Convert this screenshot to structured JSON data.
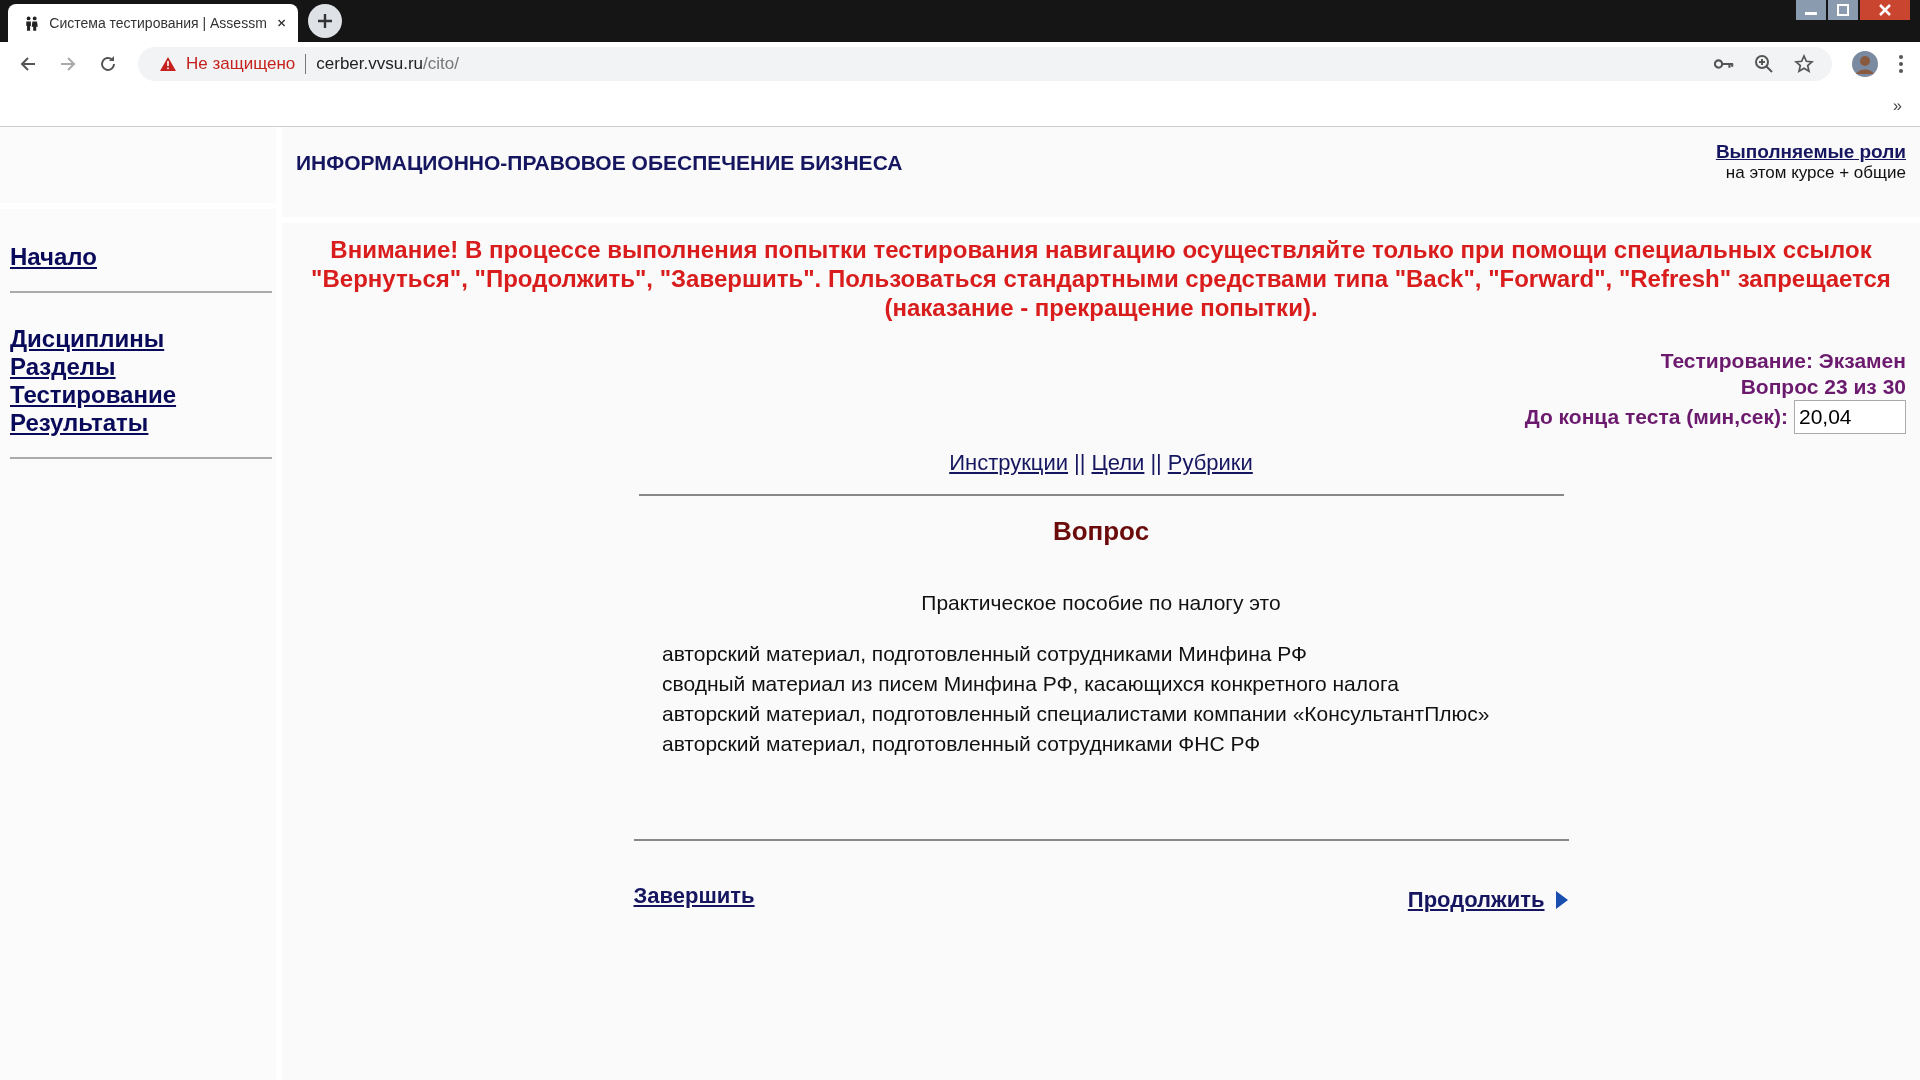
{
  "browser": {
    "tab_title": "Система тестирования | Assessm",
    "security": "Не защищено",
    "url_host": "cerber.vvsu.ru",
    "url_path": "/cito/",
    "bookmarks_more": "»"
  },
  "header": {
    "course_title": "ИНФОРМАЦИОННО-ПРАВОВОЕ ОБЕСПЕЧЕНИЕ БИЗНЕСА",
    "roles_link": "Выполняемые роли",
    "roles_note": "на этом курсе + общие"
  },
  "sidebar": {
    "home": "Начало",
    "items": [
      "Дисциплины",
      "Разделы",
      "Тестирование",
      "Результаты"
    ]
  },
  "warning": "Внимание! В процессе выполнения попытки тестирования навигацию осуществляйте только при помощи специальных ссылок \"Вернуться\", \"Продолжить\", \"Завершить\". Пользоваться стандартными средствами типа \"Back\", \"Forward\", \"Refresh\" запрещается (наказание - прекращение попытки).",
  "status": {
    "test": "Тестирование: Экзамен",
    "question": "Вопрос 23 из 30",
    "timer_label": "До конца теста (мин,сек):",
    "timer_value": "20,04"
  },
  "links": [
    {
      "label": "Инструкции"
    },
    {
      "label": "Цели"
    },
    {
      "label": "Рубрики"
    }
  ],
  "link_separator": "||",
  "question": {
    "heading": "Вопрос",
    "text": "Практическое пособие по налогу это",
    "options": [
      "авторский материал, подготовленный сотрудниками Минфина РФ",
      "сводный материал из писем Минфина РФ, касающихся конкретного налога",
      "авторский материал, подготовленный специалистами компании «КонсультантПлюс»",
      "авторский материал, подготовленный сотрудниками ФНС РФ"
    ]
  },
  "footer": {
    "finish": "Завершить",
    "next": "Продолжить"
  }
}
